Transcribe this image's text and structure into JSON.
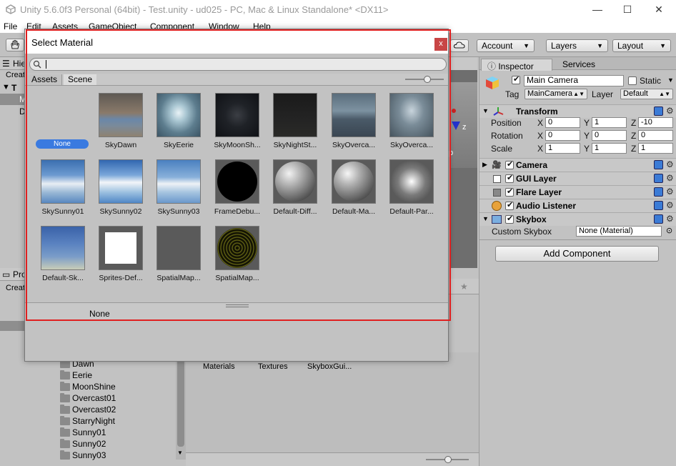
{
  "window": {
    "title": "Unity 5.6.0f3 Personal (64bit) - Test.unity - ud025 - PC, Mac & Linux Standalone* <DX11>",
    "min": "—",
    "max": "☐",
    "close": "✕"
  },
  "menu": [
    "File",
    "Edit",
    "Assets",
    "GameObject",
    "Component",
    "Window",
    "Help"
  ],
  "toolbar": {
    "account": "Account",
    "layers": "Layers",
    "layout": "Layout"
  },
  "hierarchy": {
    "tab": "Hie",
    "create": "Creat",
    "root": "T",
    "items": [
      "M",
      "D"
    ]
  },
  "project": {
    "tab": "Pro",
    "create": "Creat",
    "folders": [
      "Dawn",
      "Eerie",
      "MoonShine",
      "Overcast01",
      "Overcast02",
      "StarryNight",
      "Sunny01",
      "Sunny02",
      "Sunny03"
    ],
    "assets": [
      "Materials",
      "Textures",
      "SkyboxGui..."
    ]
  },
  "inspector": {
    "tabs": [
      "Inspector",
      "Services"
    ],
    "object_name": "Main Camera",
    "static_label": "Static",
    "tag_label": "Tag",
    "tag_value": "MainCamera",
    "layer_label": "Layer",
    "layer_value": "Default",
    "transform": {
      "title": "Transform",
      "rows": [
        {
          "label": "Position",
          "x": "0",
          "y": "1",
          "z": "-10"
        },
        {
          "label": "Rotation",
          "x": "0",
          "y": "0",
          "z": "0"
        },
        {
          "label": "Scale",
          "x": "1",
          "y": "1",
          "z": "1"
        }
      ]
    },
    "axis": [
      "X",
      "Y",
      "Z"
    ],
    "components": [
      "Camera",
      "GUI Layer",
      "Flare Layer",
      "Audio Listener",
      "Skybox"
    ],
    "custom_skybox_label": "Custom Skybox",
    "custom_skybox_value": "None (Material)",
    "add_component": "Add Component"
  },
  "dialog": {
    "title": "Select Material",
    "close": "x",
    "tabs": [
      "Assets",
      "Scene"
    ],
    "none_label": "None",
    "items": [
      "SkyDawn",
      "SkyEerie",
      "SkyMoonSh...",
      "SkyNightSt...",
      "SkyOverca...",
      "SkyOverca...",
      "SkySunny01",
      "SkySunny02",
      "SkySunny03",
      "FrameDebu...",
      "Default-Diff...",
      "Default-Ma...",
      "Default-Par...",
      "Default-Sk...",
      "Sprites-Def...",
      "SpatialMap...",
      "SpatialMap..."
    ],
    "footer": "None"
  },
  "scene": {
    "gizmo_z": "z",
    "persp": "p"
  }
}
